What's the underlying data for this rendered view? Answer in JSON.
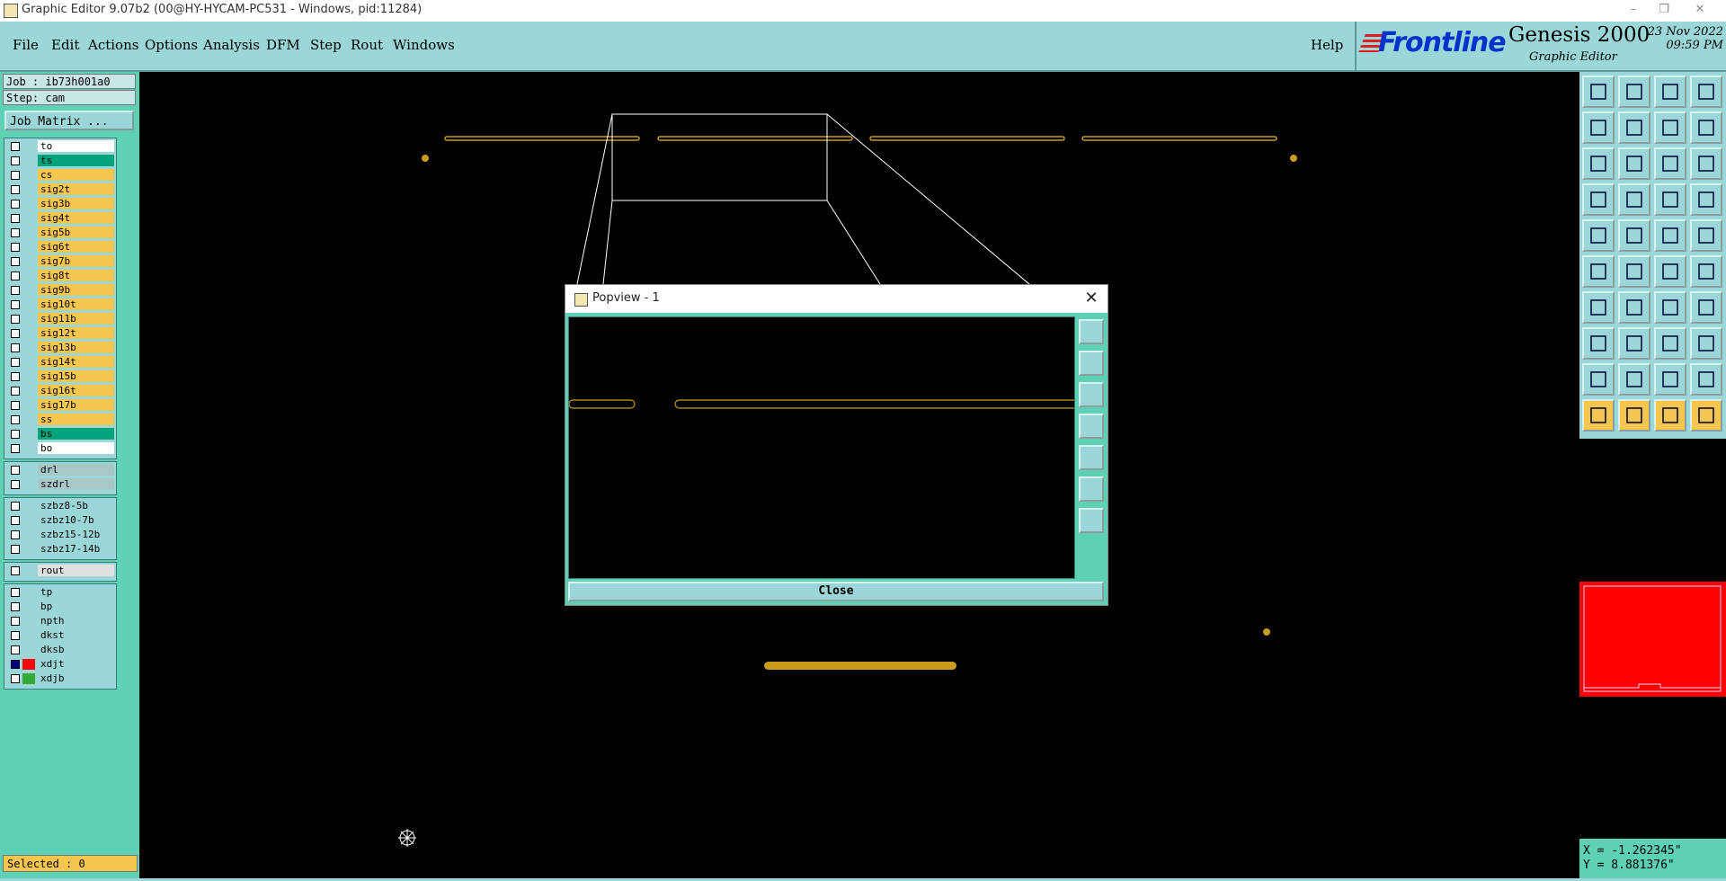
{
  "window": {
    "title": "Graphic Editor 9.07b2 (00@HY-HYCAM-PC531 - Windows, pid:11284)"
  },
  "menubar": {
    "items": [
      {
        "label": "File"
      },
      {
        "label": "Edit"
      },
      {
        "label": "Actions"
      },
      {
        "label": "Options"
      },
      {
        "label": "Analysis"
      },
      {
        "label": "DFM"
      },
      {
        "label": "Step"
      },
      {
        "label": "Rout"
      },
      {
        "label": "Windows"
      }
    ],
    "help": "Help"
  },
  "brand": {
    "logo": "Frontline",
    "product": "Genesis 2000",
    "subtitle": "Graphic Editor",
    "date": "23 Nov 2022",
    "time": "09:59 PM"
  },
  "leftpanel": {
    "job": "Job : ib73h001a0",
    "step": "Step: cam",
    "job_matrix": "Job Matrix ...",
    "selected": "Selected : 0",
    "groups": [
      {
        "layers": [
          {
            "name": "to",
            "color": "#ffffff",
            "checked": false
          },
          {
            "name": "ts",
            "color": "#00a37a",
            "checked": false
          },
          {
            "name": "cs",
            "color": "#f7c64f",
            "checked": false
          },
          {
            "name": "sig2t",
            "color": "#f7c64f",
            "checked": false
          },
          {
            "name": "sig3b",
            "color": "#f7c64f",
            "checked": false
          },
          {
            "name": "sig4t",
            "color": "#f7c64f",
            "checked": false
          },
          {
            "name": "sig5b",
            "color": "#f7c64f",
            "checked": false
          },
          {
            "name": "sig6t",
            "color": "#f7c64f",
            "checked": false
          },
          {
            "name": "sig7b",
            "color": "#f7c64f",
            "checked": false
          },
          {
            "name": "sig8t",
            "color": "#f7c64f",
            "checked": false
          },
          {
            "name": "sig9b",
            "color": "#f7c64f",
            "checked": false
          },
          {
            "name": "sig10t",
            "color": "#f7c64f",
            "checked": false
          },
          {
            "name": "sig11b",
            "color": "#f7c64f",
            "checked": false
          },
          {
            "name": "sig12t",
            "color": "#f7c64f",
            "checked": false
          },
          {
            "name": "sig13b",
            "color": "#f7c64f",
            "checked": false
          },
          {
            "name": "sig14t",
            "color": "#f7c64f",
            "checked": false
          },
          {
            "name": "sig15b",
            "color": "#f7c64f",
            "checked": false
          },
          {
            "name": "sig16t",
            "color": "#f7c64f",
            "checked": false
          },
          {
            "name": "sig17b",
            "color": "#f7c64f",
            "checked": false
          },
          {
            "name": "ss",
            "color": "#f7c64f",
            "checked": false
          },
          {
            "name": "bs",
            "color": "#00a37a",
            "checked": false
          },
          {
            "name": "bo",
            "color": "#ffffff",
            "checked": false
          }
        ]
      },
      {
        "layers": [
          {
            "name": "drl",
            "color": "#a8c8c8",
            "checked": false
          },
          {
            "name": "szdrl",
            "color": "#a8c8c8",
            "checked": false
          }
        ]
      },
      {
        "layers": [
          {
            "name": "szbz8-5b",
            "color": "#9bd6d8",
            "checked": false
          },
          {
            "name": "szbz10-7b",
            "color": "#9bd6d8",
            "checked": false
          },
          {
            "name": "szbz15-12b",
            "color": "#9bd6d8",
            "checked": false
          },
          {
            "name": "szbz17-14b",
            "color": "#9bd6d8",
            "checked": false
          }
        ]
      },
      {
        "layers": [
          {
            "name": "rout",
            "color": "#e0e0e0",
            "checked": false
          }
        ]
      },
      {
        "layers": [
          {
            "name": "tp",
            "color": "#9bd6d8",
            "checked": false
          },
          {
            "name": "bp",
            "color": "#9bd6d8",
            "checked": false
          },
          {
            "name": "npth",
            "color": "#9bd6d8",
            "checked": false
          },
          {
            "name": "dkst",
            "color": "#9bd6d8",
            "checked": false
          },
          {
            "name": "dksb",
            "color": "#9bd6d8",
            "checked": false
          },
          {
            "name": "xdjt",
            "color": "#9bd6d8",
            "checked": true,
            "swatch": "#ff0000"
          },
          {
            "name": "xdjb",
            "color": "#9bd6d8",
            "checked": false,
            "swatch": "#33aa33"
          }
        ]
      }
    ]
  },
  "popview": {
    "title": "Popview - 1",
    "close_label": "Close"
  },
  "coords": {
    "x": "X = -1.262345\"",
    "y": "Y = 8.881376\""
  },
  "colors": {
    "trace": "#c89b1c",
    "panel": "#9bd6d8",
    "panel_dark": "#5ed0b4",
    "highlight": "#f7c64f"
  }
}
